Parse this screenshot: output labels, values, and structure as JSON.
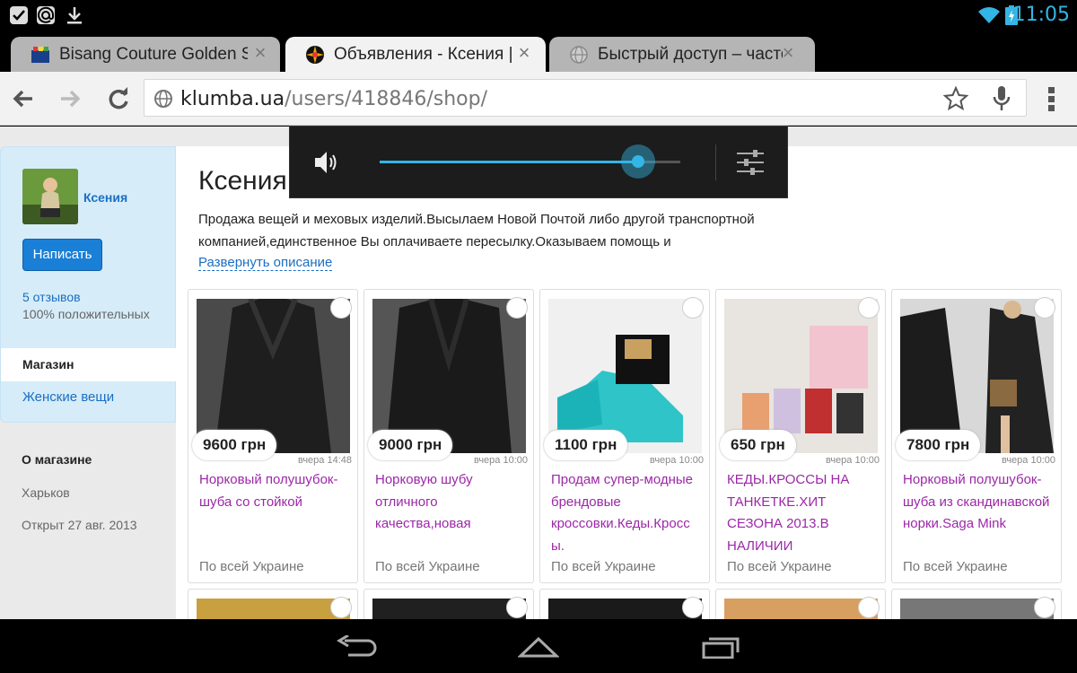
{
  "status_bar": {
    "time": "11:05",
    "icons": [
      "check-icon",
      "at-sign-icon",
      "download-icon",
      "wifi-icon",
      "battery-icon"
    ]
  },
  "tabs": [
    {
      "title": "Bisang Couture Golden Sa",
      "active": false
    },
    {
      "title": "Объявления - Ксения |",
      "active": true
    },
    {
      "title": "Быстрый доступ – часто",
      "active": false
    }
  ],
  "toolbar": {
    "url_host": "klumba.ua",
    "url_path": "/users/418846/shop/"
  },
  "sidebar": {
    "user_name": "Ксения",
    "write_button": "Написать",
    "reviews": "5 отзывов",
    "positive": "100% положительных",
    "shop_tab": "Магазин",
    "women_link": "Женские вещи",
    "about_heading": "О магазине",
    "city": "Харьков",
    "opened": "Открыт 27 авг. 2013"
  },
  "shop": {
    "title": "Ксения",
    "desc_line1": "Продажа вещей и меховых изделий.Высылаем Новой Почтой либо другой транспортной",
    "desc_line2": "компанией,единственное Вы оплачиваете пересылку.Оказываем помощь и",
    "expand": "Развернуть описание"
  },
  "listings": [
    {
      "price": "9600 грн",
      "time": "вчера 14:48",
      "title": "Норковый полушубок-шуба со стойкой",
      "region": "По всей Украине"
    },
    {
      "price": "9000 грн",
      "time": "вчера 10:00",
      "title": "Норковую шубу отличного качества,новая",
      "region": "По всей Украине"
    },
    {
      "price": "1100 грн",
      "time": "вчера 10:00",
      "title": "Продам супер-модные брендовые кроссовки.Кеды.Кросс ы.",
      "region": "По всей Украине"
    },
    {
      "price": "650 грн",
      "time": "вчера 10:00",
      "title": "КЕДЫ.КРОССЫ НА ТАНКЕТКЕ.ХИТ СЕЗОНА 2013.В НАЛИЧИИ",
      "region": "По всей Украине"
    },
    {
      "price": "7800 грн",
      "time": "вчера 10:00",
      "title": "Норковый полушубок-шуба из скандинавской норки.Saga Mink",
      "region": "По всей Украине"
    }
  ],
  "volume": {
    "level": 0.86
  },
  "colors": {
    "accent": "#33b5e5",
    "link": "#1a6fc4",
    "listing_title": "#9c27a8"
  }
}
